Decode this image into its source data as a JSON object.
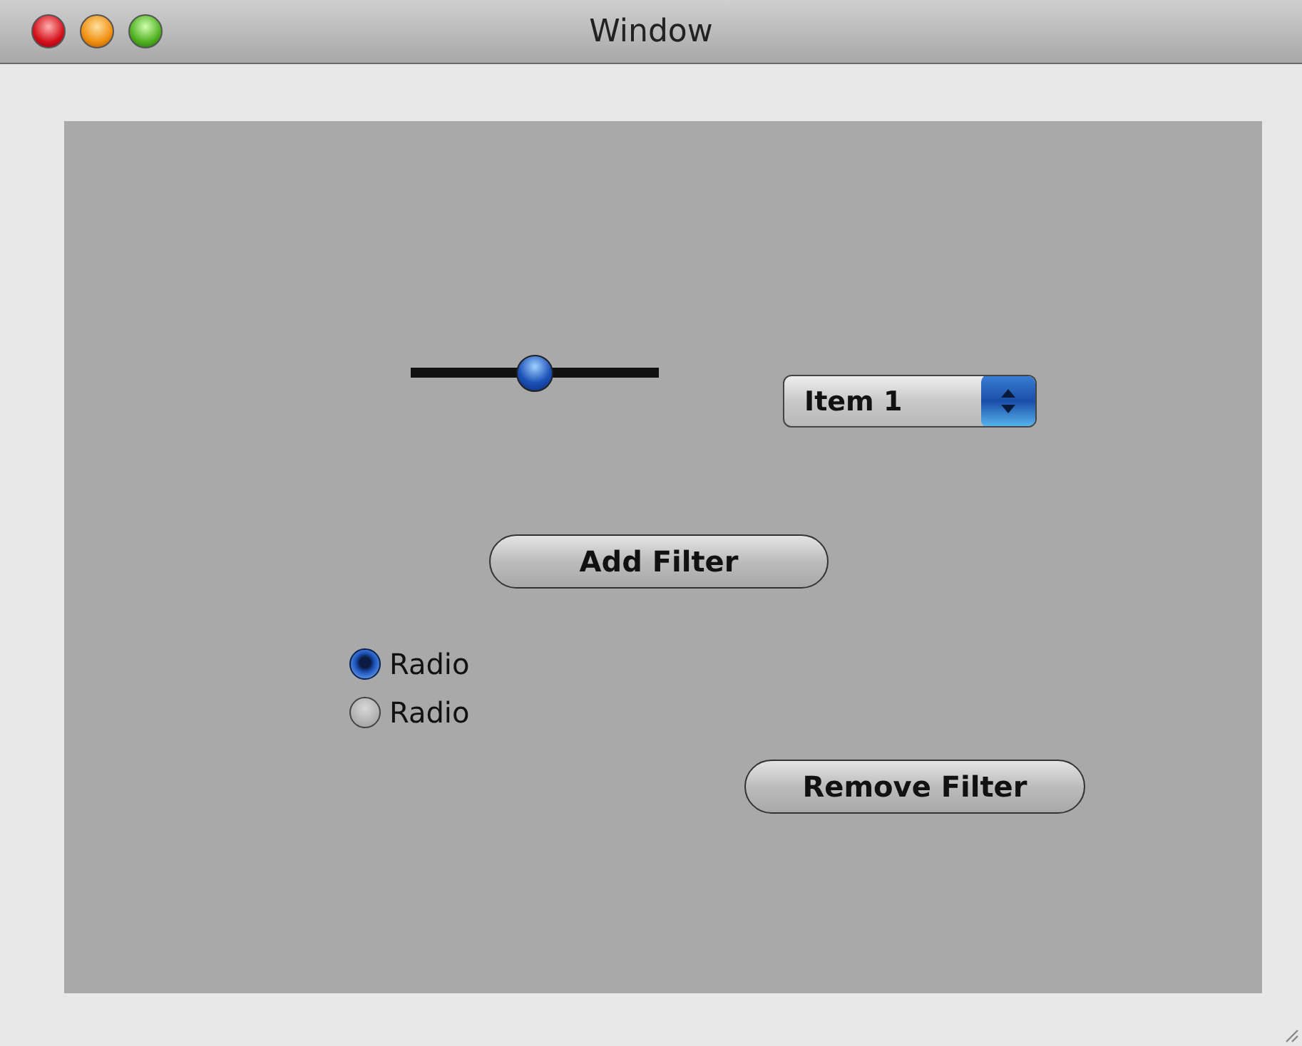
{
  "window": {
    "title": "Window"
  },
  "slider": {
    "level": 0.5
  },
  "popup": {
    "value": "Item 1"
  },
  "buttons": [
    {
      "label": "Add Filter"
    },
    {
      "label": "Remove Filter"
    }
  ],
  "radios": [
    {
      "label": "Radio",
      "selected": true
    },
    {
      "label": "Radio",
      "selected": false
    }
  ]
}
